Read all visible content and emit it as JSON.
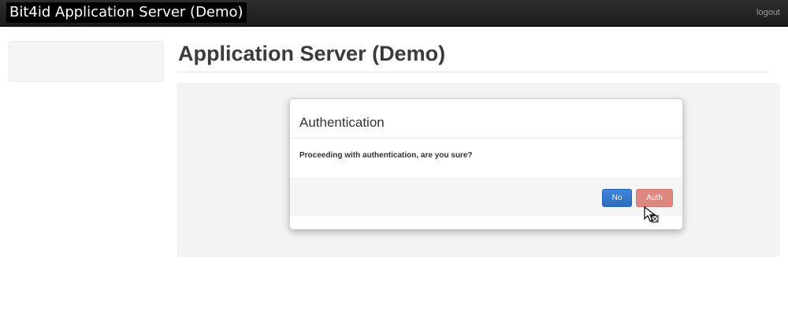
{
  "header": {
    "app_title": "Bit4id Application Server (Demo)",
    "logout_label": "logout"
  },
  "main": {
    "page_title": "Application Server (Demo)"
  },
  "modal": {
    "title": "Authentication",
    "message": "Proceeding with authentication, are you sure?",
    "no_label": "No",
    "auth_label": "Auth"
  },
  "colors": {
    "topbar": "#1f1f1f",
    "no_button": "#2f74cc",
    "auth_button": "#dd8780"
  },
  "icons": {
    "cursor": "mouse-pointer-icon"
  }
}
